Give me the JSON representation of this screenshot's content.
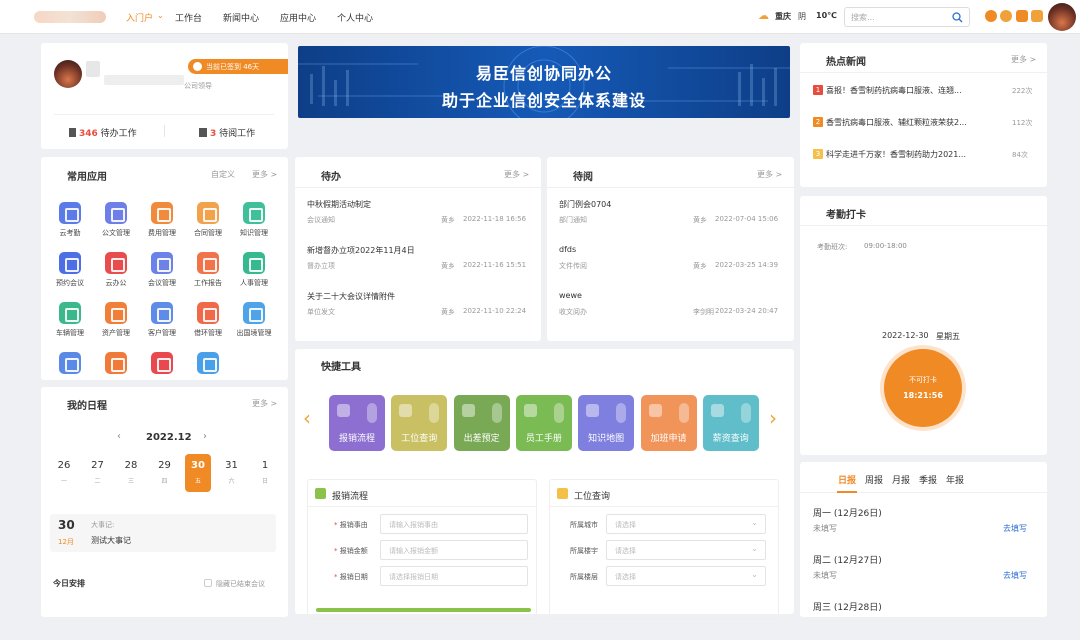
{
  "topbar": {
    "nav": [
      "入门户",
      "工作台",
      "新闻中心",
      "应用中心",
      "个人中心"
    ],
    "weather_city": "重庆",
    "weather_state": "阴",
    "weather_temp": "10℃",
    "search_placeholder": "搜索..."
  },
  "profile": {
    "role": "公司领导",
    "badge": "当前已签到 46天",
    "todo_count": "346",
    "todo_label": "待办工作",
    "read_count": "3",
    "read_label": "待阅工作"
  },
  "apps": {
    "title": "常用应用",
    "customize": "自定义",
    "more": "更多 >",
    "items": [
      {
        "label": "云考勤",
        "color": "#5b7be8"
      },
      {
        "label": "公文管理",
        "color": "#6f7fe9"
      },
      {
        "label": "费用管理",
        "color": "#f08a3c"
      },
      {
        "label": "合同管理",
        "color": "#f2a24a"
      },
      {
        "label": "知识管理",
        "color": "#3fbf9a"
      },
      {
        "label": "预约会议",
        "color": "#4e6ee6"
      },
      {
        "label": "云办公",
        "color": "#e84c4c"
      },
      {
        "label": "会议管理",
        "color": "#6d82e8"
      },
      {
        "label": "工作报告",
        "color": "#f0734a"
      },
      {
        "label": "人事管理",
        "color": "#36b98f"
      },
      {
        "label": "车辆管理",
        "color": "#3cb98c"
      },
      {
        "label": "资产管理",
        "color": "#f07f3a"
      },
      {
        "label": "客户管理",
        "color": "#5f8ce8"
      },
      {
        "label": "借环管理",
        "color": "#f06a4a"
      },
      {
        "label": "出国境管理",
        "color": "#4fa3e8"
      },
      {
        "label": "",
        "color": "#5b8ae6"
      },
      {
        "label": "",
        "color": "#f07a3a"
      },
      {
        "label": "",
        "color": "#e8484e"
      },
      {
        "label": "",
        "color": "#4aa0e8"
      }
    ]
  },
  "banner": {
    "line1": "易臣信创协同办公",
    "line2": "助于企业信创安全体系建设"
  },
  "todo": {
    "title": "待办",
    "more": "更多 >",
    "items": [
      {
        "title": "中秋假期活动制定",
        "type": "会议通知",
        "user": "黄乡",
        "time": "2022-11-18 16:56"
      },
      {
        "title": "新增督办立项2022年11月4日",
        "type": "督办立项",
        "user": "黄乡",
        "time": "2022-11-16 15:51"
      },
      {
        "title": "关于二十大会议详情附件",
        "type": "单位发文",
        "user": "黄乡",
        "time": "2022-11-10 22:24"
      }
    ]
  },
  "toread": {
    "title": "待阅",
    "more": "更多 >",
    "items": [
      {
        "title": "部门例会0704",
        "type": "部门通知",
        "user": "黄乡",
        "time": "2022-07-04 15:06"
      },
      {
        "title": "dfds",
        "type": "文件传阅",
        "user": "黄乡",
        "time": "2022-03-25 14:39"
      },
      {
        "title": "wewe",
        "type": "收文阅办",
        "user": "李剑明",
        "time": "2022-03-24 20:47"
      }
    ]
  },
  "quick": {
    "title": "快捷工具",
    "tools": [
      {
        "label": "报销流程",
        "color": "#8c6fd0"
      },
      {
        "label": "工位查询",
        "color": "#c9c063"
      },
      {
        "label": "出差预定",
        "color": "#79a955"
      },
      {
        "label": "员工手册",
        "color": "#7bbb53"
      },
      {
        "label": "知识地图",
        "color": "#7f7fe0"
      },
      {
        "label": "加班申请",
        "color": "#f0945a"
      },
      {
        "label": "薪资查询",
        "color": "#5fbec9"
      }
    ]
  },
  "form1": {
    "title": "报销流程",
    "fields": [
      {
        "label": "报销事由",
        "placeholder": "请输入报销事由"
      },
      {
        "label": "报销金额",
        "placeholder": "请输入报销金额"
      },
      {
        "label": "报销日期",
        "placeholder": "请选择报销日期"
      }
    ]
  },
  "form2": {
    "title": "工位查询",
    "fields": [
      {
        "label": "所属城市",
        "placeholder": "请选择"
      },
      {
        "label": "所属楼宇",
        "placeholder": "请选择"
      },
      {
        "label": "所属楼层",
        "placeholder": "请选择"
      }
    ]
  },
  "schedule": {
    "title": "我的日程",
    "more": "更多 >",
    "month": "2022.12",
    "days": [
      {
        "n": "26",
        "w": "一"
      },
      {
        "n": "27",
        "w": "二"
      },
      {
        "n": "28",
        "w": "三"
      },
      {
        "n": "29",
        "w": "四"
      },
      {
        "n": "30",
        "w": "五"
      },
      {
        "n": "31",
        "w": "六"
      },
      {
        "n": "1",
        "w": "日"
      }
    ],
    "event_day": "30",
    "event_month": "12月",
    "event_label": "大事记:",
    "event_text": "测试大事记",
    "today_label": "今日安排",
    "checkbox_label": "隐藏已结束会议"
  },
  "news": {
    "title": "热点新闻",
    "more": "更多 >",
    "items": [
      {
        "rank": "1",
        "color": "#e84c3d",
        "text": "喜报！香雪制药抗病毒口服液、连翘...",
        "views": "222次"
      },
      {
        "rank": "2",
        "color": "#f08a24",
        "text": "香雪抗病毒口服液、辅红颗粒液荣获2...",
        "views": "112次"
      },
      {
        "rank": "3",
        "color": "#f5c04a",
        "text": "科学走进千万家！香雪制药助力2021...",
        "views": "84次"
      }
    ]
  },
  "attendance": {
    "title": "考勤打卡",
    "shift_label": "考勤班次:",
    "shift_time": "09:00-18:00",
    "date": "2022-12-30",
    "weekday": "星期五",
    "btn_label": "不可打卡",
    "btn_time": "18:21:56"
  },
  "report": {
    "tabs": [
      "日报",
      "周报",
      "月报",
      "季报",
      "年报"
    ],
    "items": [
      {
        "day": "周一 (12月26日)",
        "status": "未填写",
        "action": "去填写"
      },
      {
        "day": "周二 (12月27日)",
        "status": "未填写",
        "action": "去填写"
      },
      {
        "day": "周三 (12月28日)",
        "status": "",
        "action": ""
      }
    ]
  }
}
